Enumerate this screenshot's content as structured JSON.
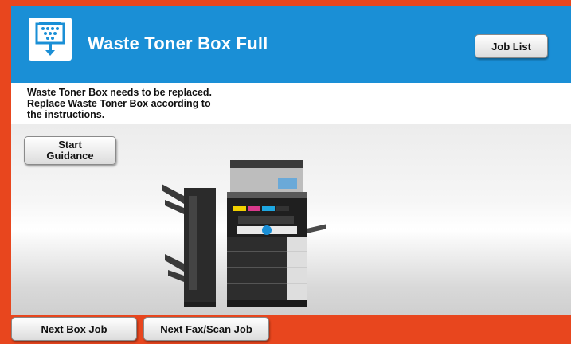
{
  "header": {
    "title": "Waste Toner Box Full",
    "icon": "waste-toner-icon",
    "job_list_label": "Job List",
    "color": "#1a8fd6"
  },
  "message": {
    "line1": "Waste Toner Box needs to be replaced.",
    "line2": "Replace Waste Toner Box according to",
    "line3": "the instructions."
  },
  "guidance": {
    "line1": "Start",
    "line2": "Guidance"
  },
  "footer": {
    "next_box_job_label": "Next Box Job",
    "next_fax_scan_job_label": "Next Fax/Scan Job",
    "color": "#e8461e"
  }
}
